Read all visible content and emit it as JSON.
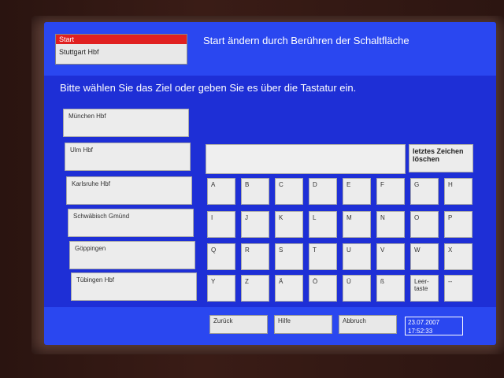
{
  "start": {
    "label": "Start",
    "value": "Stuttgart Hbf"
  },
  "header": "Start ändern durch Berühren der Schaltfläche",
  "instruction": "Bitte wählen Sie das Ziel oder geben Sie es über die Tastatur ein.",
  "destinations": [
    "München Hbf",
    "Ulm Hbf",
    "Karlsruhe Hbf",
    "Schwäbisch Gmünd",
    "Göppingen",
    "Tübingen Hbf"
  ],
  "input_value": "",
  "delete_key": "letztes Zeichen löschen",
  "keys": [
    [
      "A",
      "B",
      "C",
      "D",
      "E",
      "F",
      "G",
      "H"
    ],
    [
      "I",
      "J",
      "K",
      "L",
      "M",
      "N",
      "O",
      "P"
    ],
    [
      "Q",
      "R",
      "S",
      "T",
      "U",
      "V",
      "W",
      "X"
    ],
    [
      "Y",
      "Z",
      "Ä",
      "Ö",
      "Ü",
      "ß",
      "Leer-taste",
      "--"
    ]
  ],
  "buttons": {
    "back": "Zurück",
    "help": "Hilfe",
    "cancel": "Abbruch"
  },
  "datetime": {
    "date": "23.07.2007",
    "time": "17:52:33"
  }
}
